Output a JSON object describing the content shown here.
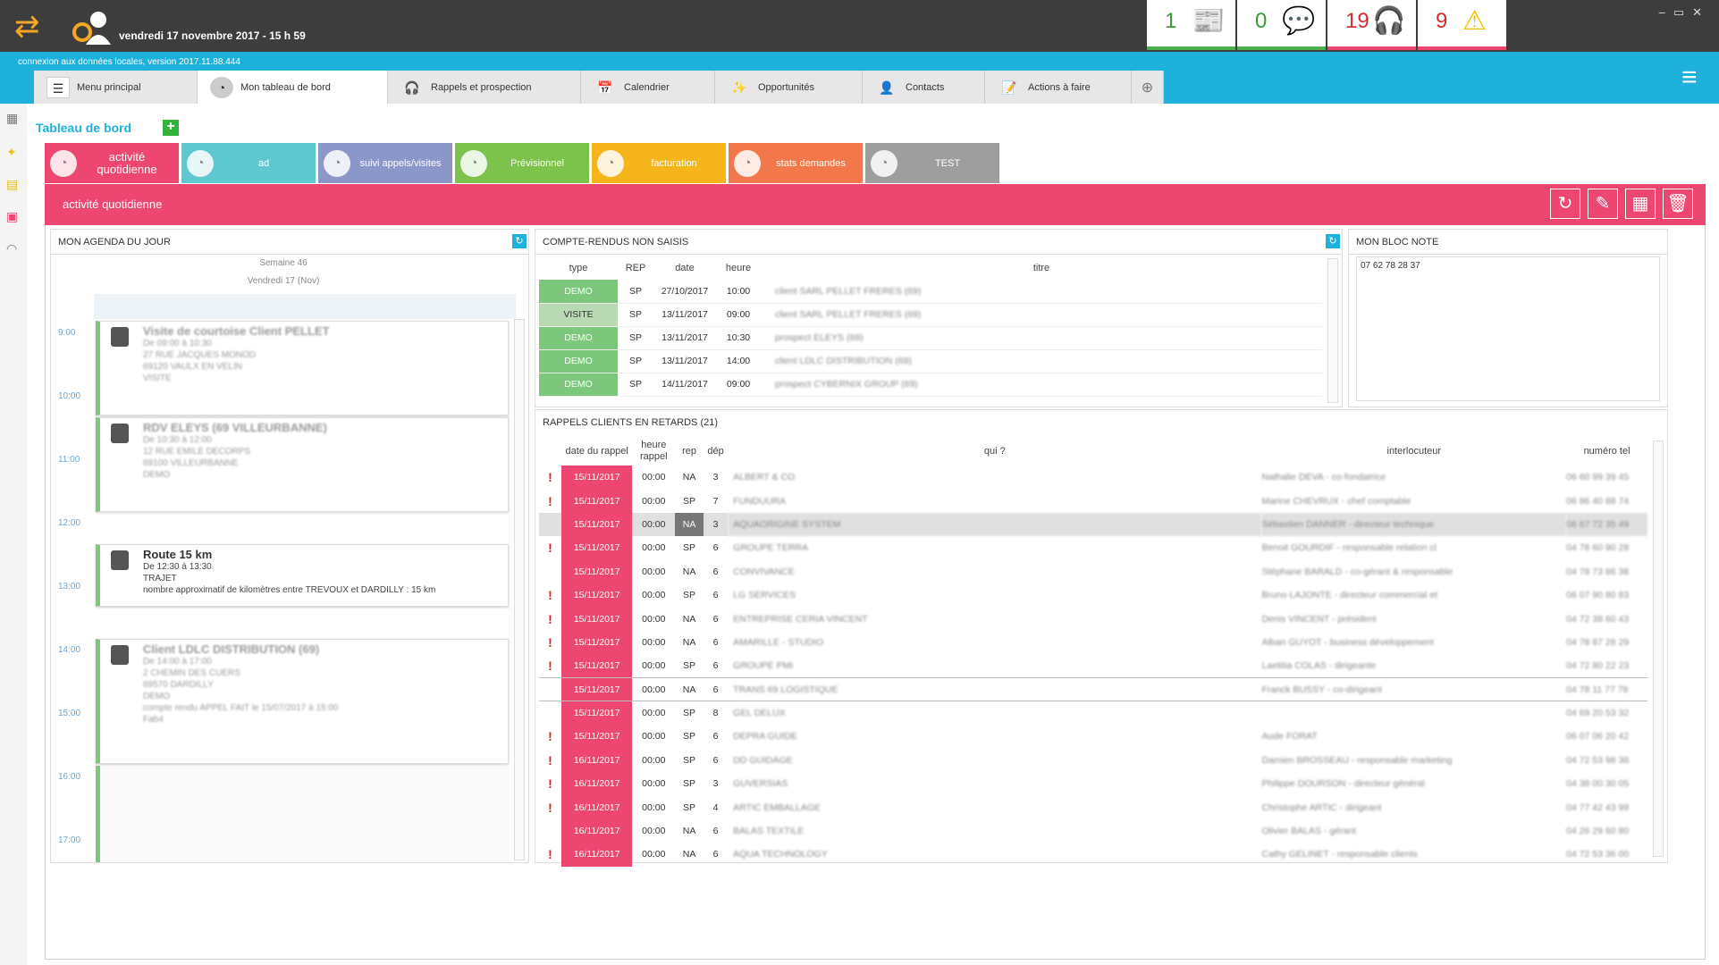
{
  "topbar": {
    "datetime": "vendredi 17 novembre 2017 - 15 h 59",
    "counters": [
      {
        "value": "1",
        "color": "#3a9a3a",
        "bar": "#4caf50",
        "icon": "news-icon"
      },
      {
        "value": "0",
        "color": "#3a9a3a",
        "bar": "#4caf50",
        "icon": "chat-icon"
      },
      {
        "value": "19",
        "color": "#d32f2f",
        "bar": "#ed4670",
        "icon": "headset-icon"
      },
      {
        "value": "9",
        "color": "#d32f2f",
        "bar": "#ed4670",
        "icon": "warning-icon"
      }
    ]
  },
  "connection": "connexion aux données locales, version 2017.11.88.444",
  "tabs": [
    "Menu principal",
    "Mon tableau de bord",
    "Rappels et prospection",
    "Calendrier",
    "Opportunités",
    "Contacts",
    "Actions à faire"
  ],
  "dashboard": {
    "title": "Tableau de bord",
    "tabs": [
      {
        "label": "activité quotidienne",
        "color": "#ed4670"
      },
      {
        "label": "ad",
        "color": "#5fc7cf"
      },
      {
        "label": "suivi appels/visites",
        "color": "#8b97c9"
      },
      {
        "label": "Prévisionnel",
        "color": "#7dc24b"
      },
      {
        "label": "facturation",
        "color": "#f5b51b"
      },
      {
        "label": "stats demandes",
        "color": "#f2784b"
      },
      {
        "label": "TEST",
        "color": "#9e9e9e"
      }
    ],
    "active": "activité quotidienne"
  },
  "agenda": {
    "title": "MON AGENDA DU JOUR",
    "week": "Semaine 46",
    "day": "Vendredi 17 (Nov)",
    "hours": [
      "9:00",
      "10:00",
      "11:00",
      "12:00",
      "13:00",
      "14:00",
      "15:00",
      "16:00",
      "17:00"
    ],
    "events": [
      {
        "title": "Visite de courtoise Client PELLET",
        "lines": [
          "De 09:00 à 10:30",
          "27 RUE JACQUES MONOD",
          "69120 VAULX EN VELIN",
          "VISITE"
        ]
      },
      {
        "title": "RDV ELEYS (69 VILLEURBANNE)",
        "lines": [
          "De 10:30 à 12:00",
          "12 RUE EMILE DECORPS",
          "69100 VILLEURBANNE",
          "DEMO"
        ]
      },
      {
        "title": "Route 15 km",
        "lines": [
          "De 12:30 à 13:30",
          "TRAJET",
          "nombre approximatif de kilomètres entre TREVOUX et DARDILLY : 15 km"
        ]
      },
      {
        "title": "Client LDLC DISTRIBUTION (69)",
        "lines": [
          "De 14:00 à 17:00",
          "2 CHEMIN DES CUERS",
          "69570 DARDILLY",
          "DEMO",
          "compte rendu APPEL FAIT le 15/07/2017 à 15:00",
          "Fab4"
        ]
      }
    ]
  },
  "comptes_rendus": {
    "title": "COMPTE-RENDUS NON SAISIS",
    "columns": [
      "type",
      "REP",
      "date",
      "heure",
      "titre"
    ],
    "rows": [
      [
        "DEMO",
        "SP",
        "27/10/2017",
        "10:00",
        "client SARL PELLET FRERES (69)"
      ],
      [
        "VISITE",
        "SP",
        "13/11/2017",
        "09:00",
        "client SARL PELLET FRERES (69)"
      ],
      [
        "DEMO",
        "SP",
        "13/11/2017",
        "10:30",
        "prospect ELEYS (69)"
      ],
      [
        "DEMO",
        "SP",
        "13/11/2017",
        "14:00",
        "client LDLC DISTRIBUTION (69)"
      ],
      [
        "DEMO",
        "SP",
        "14/11/2017",
        "09:00",
        "prospect CYBERNIX GROUP (69)"
      ]
    ]
  },
  "bloc_note": {
    "title": "MON BLOC NOTE",
    "text": "07 62 78 28 37"
  },
  "rappels": {
    "title": "RAPPELS CLIENTS EN RETARDS (21)",
    "columns": [
      "date du rappel",
      "heure rappel",
      "rep",
      "dép",
      "qui ?",
      "interlocuteur",
      "numéro tel"
    ],
    "rows": [
      [
        "!",
        "15/11/2017",
        "00:00",
        "NA",
        "3",
        "ALBERT & CO",
        "Nathalie DEVA - co-fondatrice",
        "06 60 99 39 45"
      ],
      [
        "!",
        "15/11/2017",
        "00:00",
        "SP",
        "7",
        "FUNDUURA",
        "Marine CHEVRUX - chef comptable",
        "06 86 40 88 74"
      ],
      [
        "",
        "15/11/2017",
        "00:00",
        "NA",
        "3",
        "AQUAORIGINE SYSTEM",
        "Sébastien DANNER - directeur technique",
        "06 67 72 35 49"
      ],
      [
        "!",
        "15/11/2017",
        "00:00",
        "SP",
        "6",
        "GROUPE TERRA",
        "Benoit GOURDIF - responsable relation cl",
        "04 78 60 90 28"
      ],
      [
        "",
        "15/11/2017",
        "00:00",
        "NA",
        "6",
        "CONVIVANCE",
        "Stéphane BARALD - co-gérant & responsable",
        "04 78 73 86 38"
      ],
      [
        "!",
        "15/11/2017",
        "00:00",
        "SP",
        "6",
        "LG SERVICES",
        "Bruno LAJONTE - directeur commercial et",
        "06 07 90 80 83"
      ],
      [
        "!",
        "15/11/2017",
        "00:00",
        "NA",
        "6",
        "ENTREPRISE CERIA VINCENT",
        "Denis VINCENT - président",
        "04 72 38 60 43"
      ],
      [
        "!",
        "15/11/2017",
        "00:00",
        "NA",
        "6",
        "AMARILLE - STUDIO",
        "Alban GUYOT - business développement",
        "04 78 87 28 29"
      ],
      [
        "!",
        "15/11/2017",
        "00:00",
        "SP",
        "6",
        "GROUPE PMI",
        "Laetitia COLAS - dirigeante",
        "04 72 80 22 23"
      ],
      [
        "",
        "15/11/2017",
        "00:00",
        "NA",
        "6",
        "TRANS 69 LOGISTIQUE",
        "Franck BUSSY - co-dirigeant",
        "04 78 11 77 78"
      ],
      [
        "",
        "15/11/2017",
        "00:00",
        "SP",
        "8",
        "GEL DELUX",
        "",
        "04 69 20 53 32"
      ],
      [
        "!",
        "15/11/2017",
        "00:00",
        "SP",
        "6",
        "DEPRA GUIDE",
        "Aude FORAT",
        "06 07 06 20 42"
      ],
      [
        "!",
        "16/11/2017",
        "00:00",
        "SP",
        "6",
        "DD GUIDAGE",
        "Damien BROSSEAU - responsable marketing",
        "04 72 53 98 38"
      ],
      [
        "!",
        "16/11/2017",
        "00:00",
        "SP",
        "3",
        "GUVERSIAS",
        "Philippe DOURSON - directeur général",
        "04 38 00 30 05"
      ],
      [
        "!",
        "16/11/2017",
        "00:00",
        "SP",
        "4",
        "ARTIC EMBALLAGE",
        "Christophe ARTIC - dirigeant",
        "04 77 42 43 99"
      ],
      [
        "",
        "16/11/2017",
        "00:00",
        "NA",
        "6",
        "BALAS TEXTILE",
        "Olivier BALAS - gérant",
        "04 26 29 60 80"
      ],
      [
        "!",
        "16/11/2017",
        "00:00",
        "NA",
        "6",
        "AQUA TECHNOLOGY",
        "Cathy GELINET - responsable clients",
        "04 72 53 36 00"
      ]
    ]
  }
}
